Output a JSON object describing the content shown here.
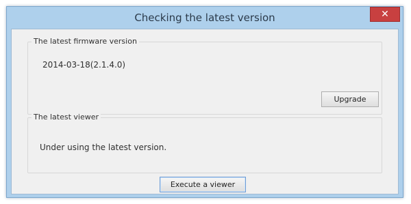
{
  "window": {
    "title": "Checking the latest version",
    "close_glyph": "✕"
  },
  "firmware_group": {
    "label": "The latest firmware version",
    "version": "2014-03-18(2.1.4.0)",
    "upgrade_label": "Upgrade"
  },
  "viewer_group": {
    "label": "The latest viewer",
    "status": "Under using the latest version."
  },
  "footer": {
    "execute_label": "Execute a viewer"
  },
  "colors": {
    "frame": "#aed0ec",
    "client": "#f0f0f0",
    "close_button": "#c84040"
  }
}
